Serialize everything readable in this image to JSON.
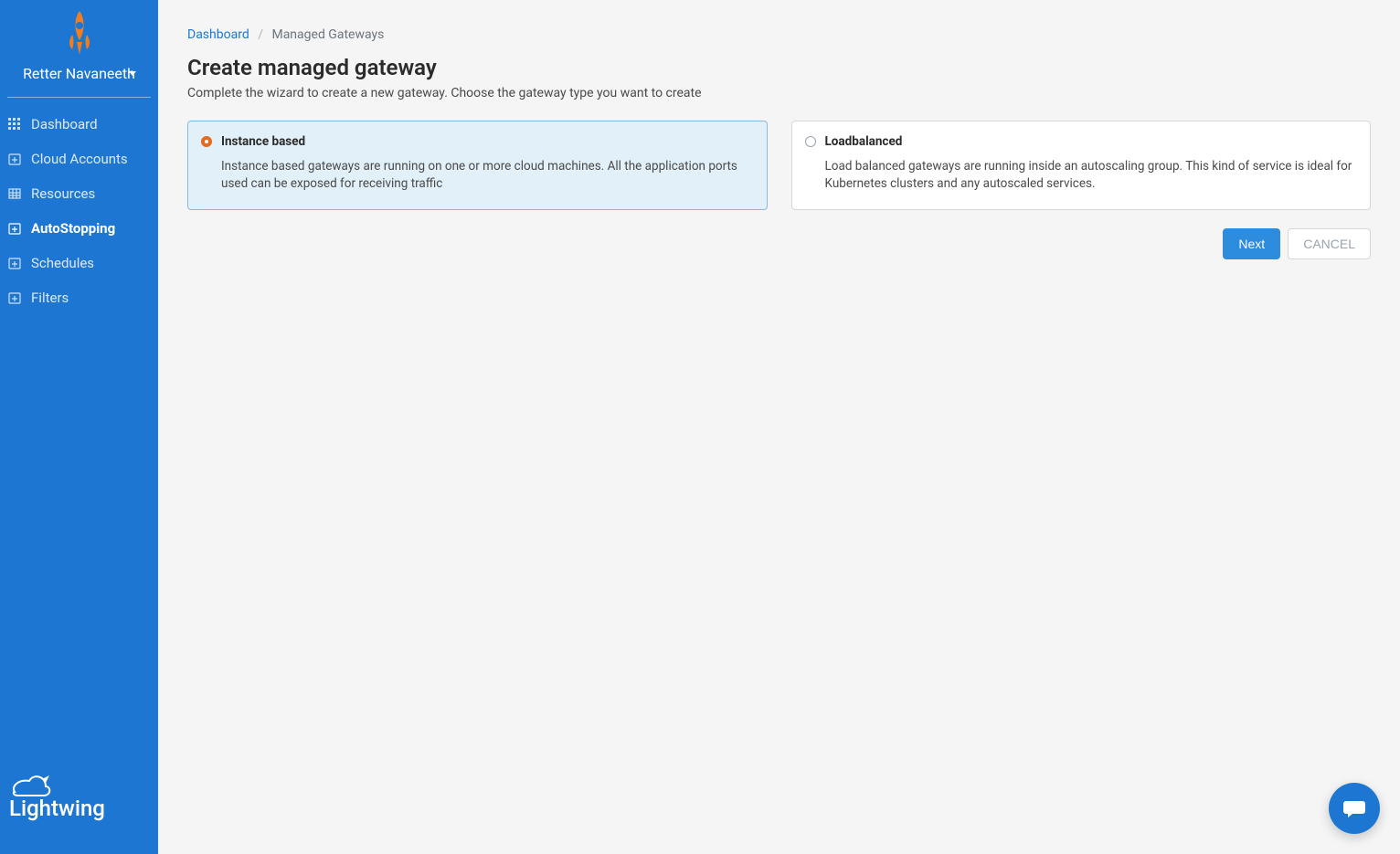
{
  "user": {
    "name": "Retter Navaneeth"
  },
  "sidebar": {
    "items": [
      {
        "label": "Dashboard",
        "icon": "grid-icon"
      },
      {
        "label": "Cloud Accounts",
        "icon": "calendar-plus-icon"
      },
      {
        "label": "Resources",
        "icon": "table-icon"
      },
      {
        "label": "AutoStopping",
        "icon": "calendar-plus-icon",
        "active": true
      },
      {
        "label": "Schedules",
        "icon": "calendar-plus-icon"
      },
      {
        "label": "Filters",
        "icon": "calendar-plus-icon"
      }
    ],
    "footer_brand": "Lightwing"
  },
  "breadcrumb": {
    "root": "Dashboard",
    "current": "Managed Gateways"
  },
  "page": {
    "title": "Create managed gateway",
    "subtitle": "Complete the wizard to create a new gateway. Choose the gateway type you want to create"
  },
  "options": [
    {
      "title": "Instance based",
      "desc": "Instance based gateways are running on one or more cloud machines. All the application ports used can be exposed for receiving traffic",
      "selected": true
    },
    {
      "title": "Loadbalanced",
      "desc": "Load balanced gateways are running inside an autoscaling group. This kind of service is ideal for Kubernetes clusters and any autoscaled services.",
      "selected": false
    }
  ],
  "actions": {
    "next": "Next",
    "cancel": "CANCEL"
  }
}
